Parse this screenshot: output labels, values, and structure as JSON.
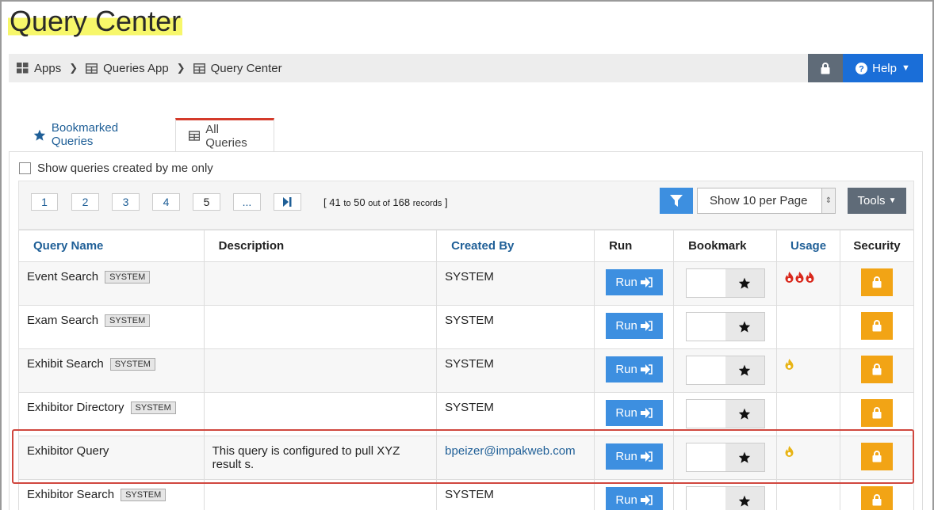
{
  "page": {
    "title": "Query Center"
  },
  "breadcrumb": [
    {
      "label": "Apps",
      "icon": "apps-grid-icon"
    },
    {
      "label": "Queries App",
      "icon": "table-icon"
    },
    {
      "label": "Query Center",
      "icon": "table-icon"
    }
  ],
  "header_actions": {
    "help_label": "Help"
  },
  "tabs": [
    {
      "label": "Bookmarked Queries",
      "icon": "star-icon",
      "active": false
    },
    {
      "label": "All Queries",
      "icon": "table-icon",
      "active": true
    }
  ],
  "filters": {
    "show_mine_label": "Show queries created by me only",
    "show_mine_checked": false
  },
  "pagination": {
    "pages": [
      "1",
      "2",
      "3",
      "4",
      "5",
      "..."
    ],
    "records_open": "[",
    "records_from": "41",
    "records_to_word": "to",
    "records_to": "50",
    "records_out_of": "out of",
    "records_total": "168",
    "records_word": "records",
    "records_close": "]"
  },
  "per_page": {
    "selected": "Show 10 per Page"
  },
  "tools": {
    "label": "Tools"
  },
  "table": {
    "headers": {
      "name": "Query Name",
      "description": "Description",
      "created_by": "Created By",
      "run": "Run",
      "bookmark": "Bookmark",
      "usage": "Usage",
      "security": "Security"
    },
    "run_label": "Run",
    "rows": [
      {
        "name": "Event Search",
        "badge": "SYSTEM",
        "description": "",
        "created_by": "SYSTEM",
        "usage_flames": 3,
        "usage_level": "high"
      },
      {
        "name": "Exam Search",
        "badge": "SYSTEM",
        "description": "",
        "created_by": "SYSTEM",
        "usage_flames": 0,
        "usage_level": "none"
      },
      {
        "name": "Exhibit Search",
        "badge": "SYSTEM",
        "description": "",
        "created_by": "SYSTEM",
        "usage_flames": 1,
        "usage_level": "low"
      },
      {
        "name": "Exhibitor Directory",
        "badge": "SYSTEM",
        "description": "",
        "created_by": "SYSTEM",
        "usage_flames": 0,
        "usage_level": "none"
      },
      {
        "name": "Exhibitor Query",
        "badge": "",
        "description": "This query is configured to pull XYZ result s.",
        "created_by": "bpeizer@impakweb.com",
        "usage_flames": 1,
        "usage_level": "low",
        "highlighted": true
      },
      {
        "name": "Exhibitor Search",
        "badge": "SYSTEM",
        "description": "",
        "created_by": "SYSTEM",
        "usage_flames": 0,
        "usage_level": "none"
      }
    ]
  },
  "colors": {
    "title_highlight": "#f7f76a",
    "primary": "#3d8fe0",
    "help": "#1a6ed8",
    "security": "#f2a415",
    "usage_high": "#d9281c",
    "usage_low": "#e8b415",
    "highlight_border": "#d0473f"
  }
}
